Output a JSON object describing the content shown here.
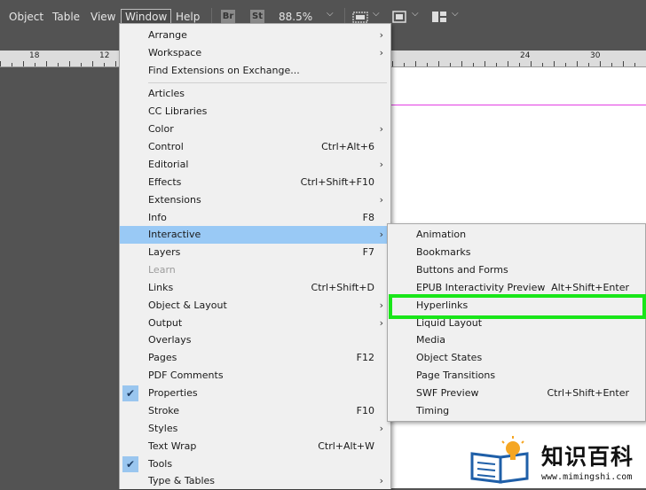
{
  "menubar": {
    "items": [
      "Object",
      "Table",
      "View",
      "Window",
      "Help"
    ],
    "bridge_badge": "Br",
    "stock_badge": "St",
    "zoom": "88.5%"
  },
  "ruler": {
    "labels": [
      "18",
      "12",
      "24",
      "30"
    ]
  },
  "window_menu": {
    "items": [
      {
        "label": "Arrange",
        "submenu": true
      },
      {
        "label": "Workspace",
        "submenu": true
      },
      {
        "label": "Find Extensions on Exchange..."
      },
      {
        "label": "Articles"
      },
      {
        "label": "CC Libraries"
      },
      {
        "label": "Color",
        "submenu": true
      },
      {
        "label": "Control",
        "shortcut": "Ctrl+Alt+6"
      },
      {
        "label": "Editorial",
        "submenu": true
      },
      {
        "label": "Effects",
        "shortcut": "Ctrl+Shift+F10"
      },
      {
        "label": "Extensions",
        "submenu": true
      },
      {
        "label": "Info",
        "shortcut": "F8"
      },
      {
        "label": "Interactive",
        "submenu": true,
        "highlighted": true
      },
      {
        "label": "Layers",
        "shortcut": "F7"
      },
      {
        "label": "Learn",
        "disabled": true
      },
      {
        "label": "Links",
        "shortcut": "Ctrl+Shift+D"
      },
      {
        "label": "Object & Layout",
        "submenu": true
      },
      {
        "label": "Output",
        "submenu": true
      },
      {
        "label": "Overlays"
      },
      {
        "label": "Pages",
        "shortcut": "F12"
      },
      {
        "label": "PDF Comments"
      },
      {
        "label": "Properties",
        "checked": true
      },
      {
        "label": "Stroke",
        "shortcut": "F10"
      },
      {
        "label": "Styles",
        "submenu": true
      },
      {
        "label": "Text Wrap",
        "shortcut": "Ctrl+Alt+W"
      },
      {
        "label": "Tools",
        "checked": true
      },
      {
        "label": "Type & Tables",
        "submenu": true
      }
    ]
  },
  "interactive_menu": {
    "items": [
      {
        "label": "Animation"
      },
      {
        "label": "Bookmarks"
      },
      {
        "label": "Buttons and Forms"
      },
      {
        "label": "EPUB Interactivity Preview",
        "shortcut": "Alt+Shift+Enter"
      },
      {
        "label": "Hyperlinks"
      },
      {
        "label": "Liquid Layout"
      },
      {
        "label": "Media"
      },
      {
        "label": "Object States"
      },
      {
        "label": "Page Transitions"
      },
      {
        "label": "SWF Preview",
        "shortcut": "Ctrl+Shift+Enter"
      },
      {
        "label": "Timing"
      }
    ]
  },
  "watermark": {
    "title": "知识百科",
    "url": "www.mimingshi.com"
  },
  "colors": {
    "highlight": "#99c9f5",
    "annotation_box": "#19e619",
    "margin_guide": "#e23ee2"
  }
}
